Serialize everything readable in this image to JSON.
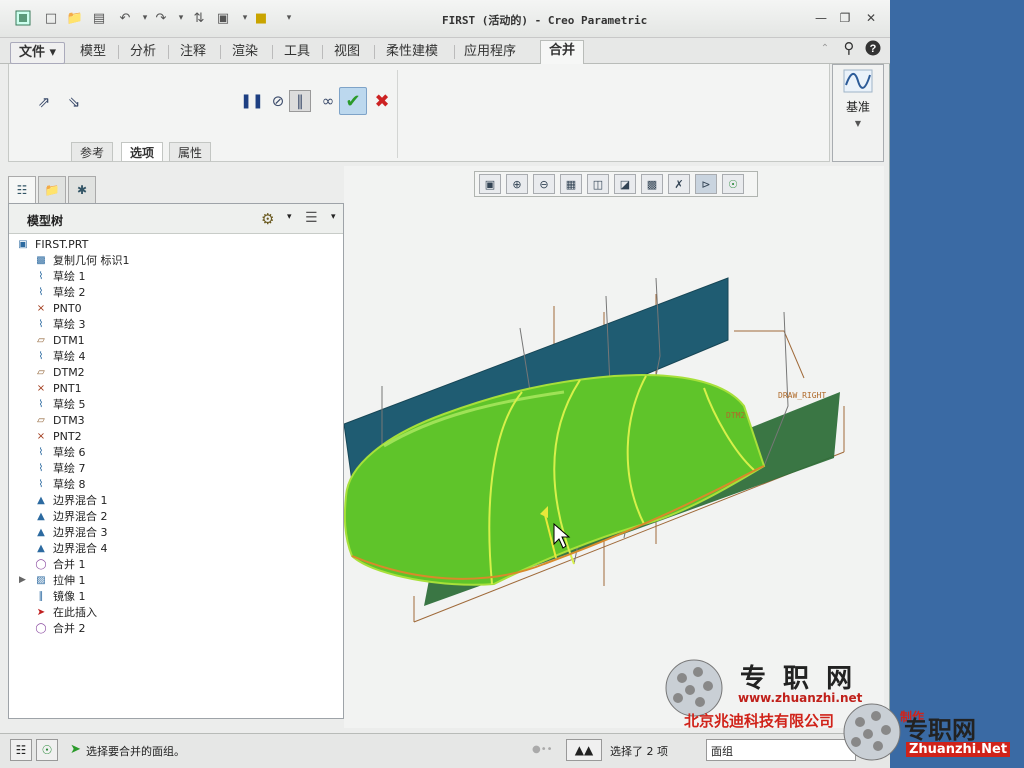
{
  "window": {
    "title": "FIRST (活动的) - Creo Parametric"
  },
  "menubar": {
    "tabs": [
      {
        "label": "文件"
      },
      {
        "label": "模型"
      },
      {
        "label": "分析"
      },
      {
        "label": "注释"
      },
      {
        "label": "渲染"
      },
      {
        "label": "工具"
      },
      {
        "label": "视图"
      },
      {
        "label": "柔性建模"
      },
      {
        "label": "应用程序"
      },
      {
        "label": "合并"
      }
    ]
  },
  "ribbon": {
    "subtabs": [
      {
        "label": "参考"
      },
      {
        "label": "选项"
      },
      {
        "label": "属性"
      }
    ],
    "datum_label": "基准"
  },
  "model_tree": {
    "title": "模型树",
    "items": [
      {
        "icon": "part-icon",
        "label": "FIRST.PRT"
      },
      {
        "icon": "copy-geom-icon",
        "label": "复制几何 标识1"
      },
      {
        "icon": "sketch-icon",
        "label": "草绘 1"
      },
      {
        "icon": "sketch-icon",
        "label": "草绘 2"
      },
      {
        "icon": "point-icon",
        "label": "PNT0"
      },
      {
        "icon": "sketch-icon",
        "label": "草绘 3"
      },
      {
        "icon": "plane-icon",
        "label": "DTM1"
      },
      {
        "icon": "sketch-icon",
        "label": "草绘 4"
      },
      {
        "icon": "plane-icon",
        "label": "DTM2"
      },
      {
        "icon": "point-icon",
        "label": "PNT1"
      },
      {
        "icon": "sketch-icon",
        "label": "草绘 5"
      },
      {
        "icon": "plane-icon",
        "label": "DTM3"
      },
      {
        "icon": "point-icon",
        "label": "PNT2"
      },
      {
        "icon": "sketch-icon",
        "label": "草绘 6"
      },
      {
        "icon": "sketch-icon",
        "label": "草绘 7"
      },
      {
        "icon": "sketch-icon",
        "label": "草绘 8"
      },
      {
        "icon": "boundary-blend-icon",
        "label": "边界混合 1"
      },
      {
        "icon": "boundary-blend-icon",
        "label": "边界混合 2"
      },
      {
        "icon": "boundary-blend-icon",
        "label": "边界混合 3"
      },
      {
        "icon": "boundary-blend-icon",
        "label": "边界混合 4"
      },
      {
        "icon": "merge-icon",
        "label": "合并 1"
      },
      {
        "icon": "extrude-icon",
        "label": "拉伸 1"
      },
      {
        "icon": "mirror-icon",
        "label": "镜像 1"
      },
      {
        "icon": "insert-here-icon",
        "label": "在此插入"
      },
      {
        "icon": "merge-icon",
        "label": "合并 2"
      }
    ]
  },
  "viewport": {
    "labels": {
      "front_right": "DRAW_RIGHT",
      "dtm2": "DTM2"
    }
  },
  "status": {
    "message": "选择要合并的面组。",
    "selected_count": "选择了 2 项",
    "filter_value": "面组"
  },
  "watermark": {
    "brand_large": "专 职 网",
    "url": "www.zhuanzhi.net",
    "company": "北京兆迪科技有限公司",
    "company_suffix": "制作",
    "brand_small": "专职网",
    "brand_small_url": "Zhuanzhi.Net"
  },
  "colors": {
    "accent": "#2c6aa0",
    "surface_green": "#5fc42a",
    "datum_plane": "#1f5c72",
    "confirm": "#2a9a2a",
    "cancel": "#cc2222"
  }
}
